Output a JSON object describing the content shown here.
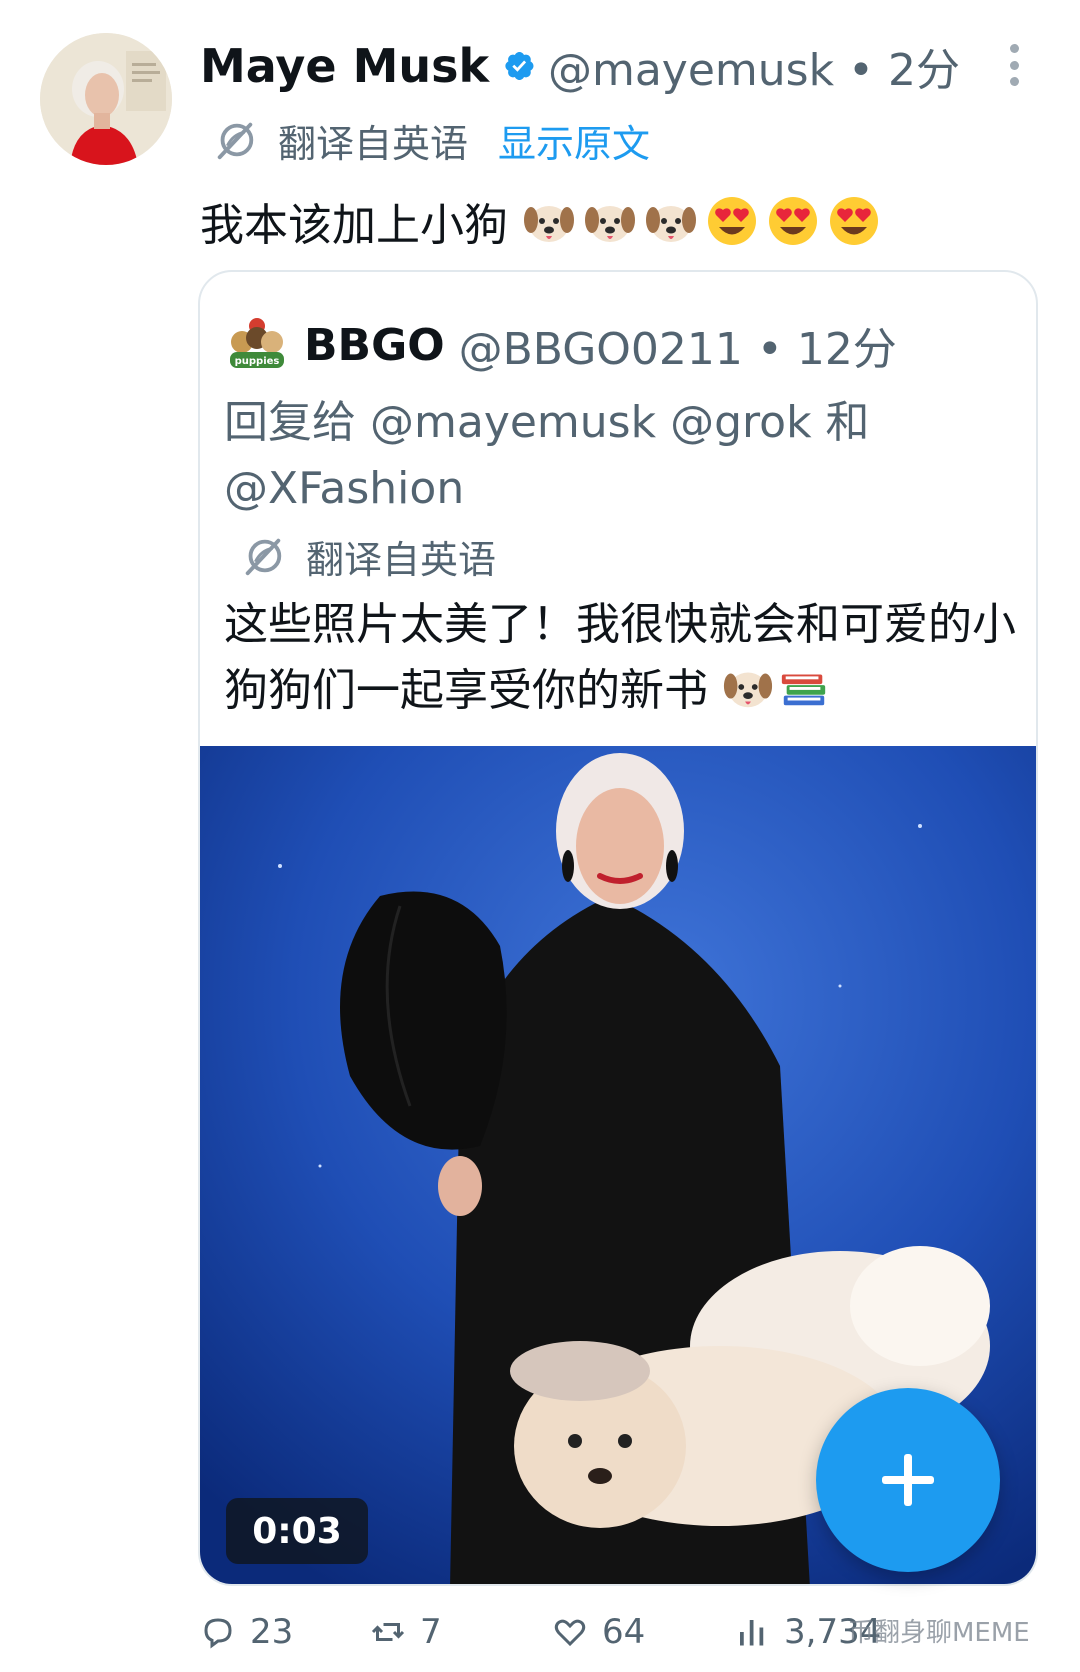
{
  "post": {
    "author_name": "Maye Musk",
    "handle_time": "@mayemusk • 2分",
    "translated_from": "翻译自英语",
    "show_original": "显示原文",
    "text": "我本该加上小狗",
    "emojis": [
      "dog-face",
      "dog-face",
      "dog-face",
      "heart-eyes",
      "heart-eyes",
      "heart-eyes"
    ]
  },
  "quote": {
    "author_name": "BBGO",
    "handle_time": "@BBGO0211 • 12分",
    "avatar_caption": "puppies",
    "reply_prefix": "回复给",
    "mention_1": "@mayemusk",
    "mention_2": "@grok",
    "reply_and": "和",
    "mention_3": "@XFashion",
    "translated_from": "翻译自英语",
    "text": "这些照片太美了！我很快就会和可爱的小狗狗们一起享受你的新书",
    "emojis": [
      "dog-face",
      "books"
    ],
    "video_duration": "0:03"
  },
  "actions": {
    "replies": "23",
    "reposts": "7",
    "likes": "64",
    "views": "3,734"
  },
  "watermark": "币翻身聊MEME",
  "colors": {
    "accent": "#1d9bf0",
    "text_primary": "#0f1419",
    "text_secondary": "#536471",
    "border": "#e1e8ed"
  }
}
